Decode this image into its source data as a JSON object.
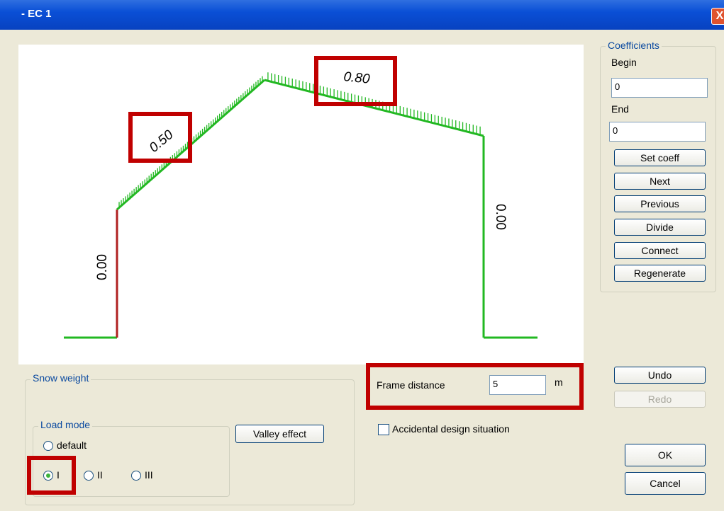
{
  "window": {
    "title": "- EC 1",
    "close_label": "X"
  },
  "diagram": {
    "left_wall_value": "0.00",
    "left_roof_value": "0.50",
    "right_roof_value": "0.80",
    "right_wall_value": "0.00"
  },
  "coefficients": {
    "legend": "Coefficients",
    "begin_label": "Begin",
    "begin_value": "0",
    "end_label": "End",
    "end_value": "0",
    "buttons": {
      "set_coeff": "Set coeff",
      "next": "Next",
      "previous": "Previous",
      "divide": "Divide",
      "connect": "Connect",
      "regenerate": "Regenerate"
    }
  },
  "snow_weight": {
    "legend": "Snow weight",
    "load_mode_legend": "Load mode",
    "default_label": "default",
    "option_i": "I",
    "option_ii": "II",
    "option_iii": "III",
    "selected": "I",
    "valley_effect": "Valley effect"
  },
  "frame": {
    "label": "Frame distance",
    "value": "5",
    "unit": "m"
  },
  "accidental": {
    "label": "Accidental design situation",
    "checked": false
  },
  "actions": {
    "undo": "Undo",
    "redo": "Redo",
    "ok": "OK",
    "cancel": "Cancel"
  },
  "colors": {
    "roof_load": "#22b822",
    "wall_left": "#b02020",
    "highlight": "#c00000",
    "title_bar": "#0a4fd6"
  }
}
